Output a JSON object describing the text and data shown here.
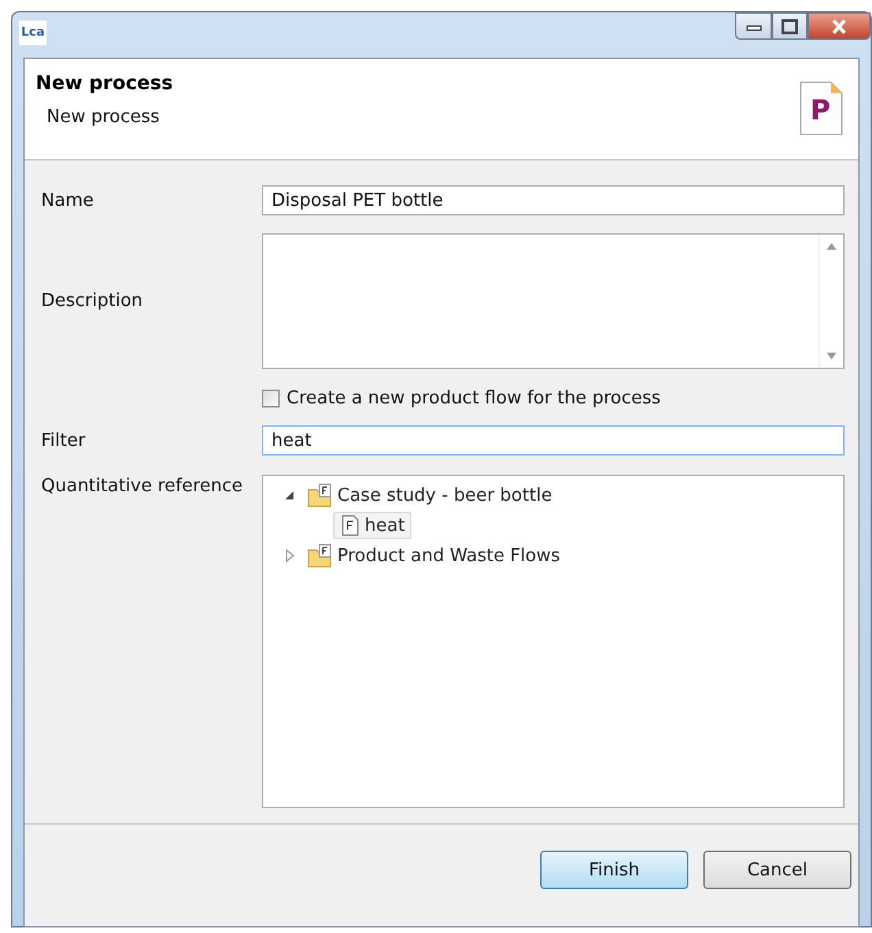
{
  "window": {
    "logo": "Lca"
  },
  "header": {
    "title": "New process",
    "subtitle": "New process",
    "icon_letter": "P"
  },
  "form": {
    "name": {
      "label": "Name",
      "value": "Disposal PET bottle"
    },
    "description": {
      "label": "Description"
    },
    "create_flow": {
      "label": "Create a new product flow for the process",
      "checked": false
    },
    "filter": {
      "label": "Filter",
      "value": "heat"
    },
    "quantitative_reference": {
      "label": "Quantitative reference",
      "tree": [
        {
          "label": "Case study - beer bottle",
          "kind": "folder",
          "expanded": true,
          "selected": false,
          "children": [
            {
              "label": "heat",
              "kind": "flow",
              "selected": true
            }
          ]
        },
        {
          "label": "Product and Waste Flows",
          "kind": "folder",
          "expanded": false,
          "selected": false
        }
      ]
    }
  },
  "buttons": [
    {
      "label": "Finish",
      "default": true
    },
    {
      "label": "Cancel",
      "default": false
    }
  ]
}
